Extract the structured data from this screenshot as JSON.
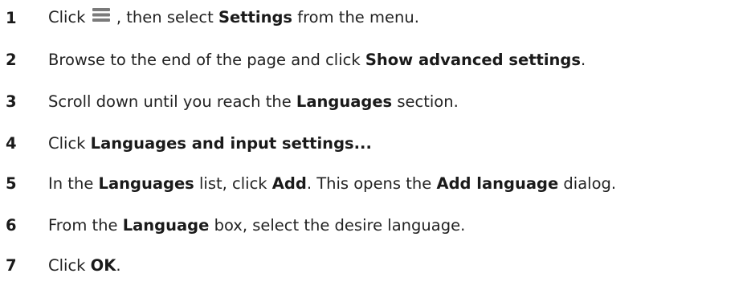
{
  "steps": [
    {
      "number": "1",
      "parts": [
        {
          "text": "Click ",
          "bold": false
        },
        {
          "icon": "menu-icon"
        },
        {
          "text": " , then select ",
          "bold": false
        },
        {
          "text": "Settings",
          "bold": true
        },
        {
          "text": " from the menu.",
          "bold": false
        }
      ]
    },
    {
      "number": "2",
      "parts": [
        {
          "text": "Browse to the end of the page and click ",
          "bold": false
        },
        {
          "text": "Show advanced settings",
          "bold": true
        },
        {
          "text": ".",
          "bold": false
        }
      ]
    },
    {
      "number": "3",
      "parts": [
        {
          "text": "Scroll down until you reach the ",
          "bold": false
        },
        {
          "text": "Languages",
          "bold": true
        },
        {
          "text": " section.",
          "bold": false
        }
      ]
    },
    {
      "number": "4",
      "parts": [
        {
          "text": "Click ",
          "bold": false
        },
        {
          "text": "Languages and input settings...",
          "bold": true
        }
      ]
    },
    {
      "number": "5",
      "parts": [
        {
          "text": "In the ",
          "bold": false
        },
        {
          "text": "Languages",
          "bold": true
        },
        {
          "text": " list, click ",
          "bold": false
        },
        {
          "text": "Add",
          "bold": true
        },
        {
          "text": ". This opens the ",
          "bold": false
        },
        {
          "text": "Add language",
          "bold": true
        },
        {
          "text": " dialog.",
          "bold": false
        }
      ]
    },
    {
      "number": "6",
      "parts": [
        {
          "text": "From the ",
          "bold": false
        },
        {
          "text": "Language",
          "bold": true
        },
        {
          "text": " box, select the desire language.",
          "bold": false
        }
      ]
    },
    {
      "number": "7",
      "parts": [
        {
          "text": "Click ",
          "bold": false
        },
        {
          "text": "OK",
          "bold": true
        },
        {
          "text": ".",
          "bold": false
        }
      ]
    }
  ]
}
